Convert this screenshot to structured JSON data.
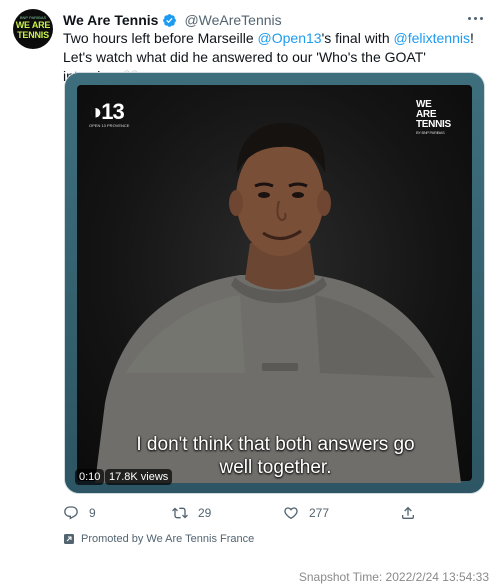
{
  "account": {
    "name": "We Are Tennis",
    "handle": "@WeAreTennis",
    "avatar_top": "BNP PARIBAS",
    "avatar_line1": "WE ARE",
    "avatar_line2": "TENNIS"
  },
  "tweet": {
    "text_1": "Two hours left before Marseille ",
    "mention_1": "@Open13",
    "text_2": "'s final with ",
    "mention_2": "@felixtennis",
    "text_3": "! Let's watch what did he answered to our 'Who's the GOAT' interview 👀"
  },
  "video": {
    "logo_big": "◑13",
    "logo_small": "OPEN 13 PROVENCE",
    "brand_line1": "WE",
    "brand_line2": "ARE",
    "brand_line3": "TENNIS",
    "brand_sub": "BY BNP PARIBAS",
    "caption_line1": "I don't think that both answers go",
    "caption_line2": "well together.",
    "time": "0:10",
    "views": "17.8K views"
  },
  "actions": {
    "replies": "9",
    "retweets": "29",
    "likes": "277"
  },
  "promoted_text": "Promoted by We Are Tennis France",
  "snapshot": "Snapshot Time:  2022/2/24 13:54:33",
  "colors": {
    "link": "#1d9bf0",
    "verified": "#1d9bf0",
    "secondary_text": "#536471"
  }
}
